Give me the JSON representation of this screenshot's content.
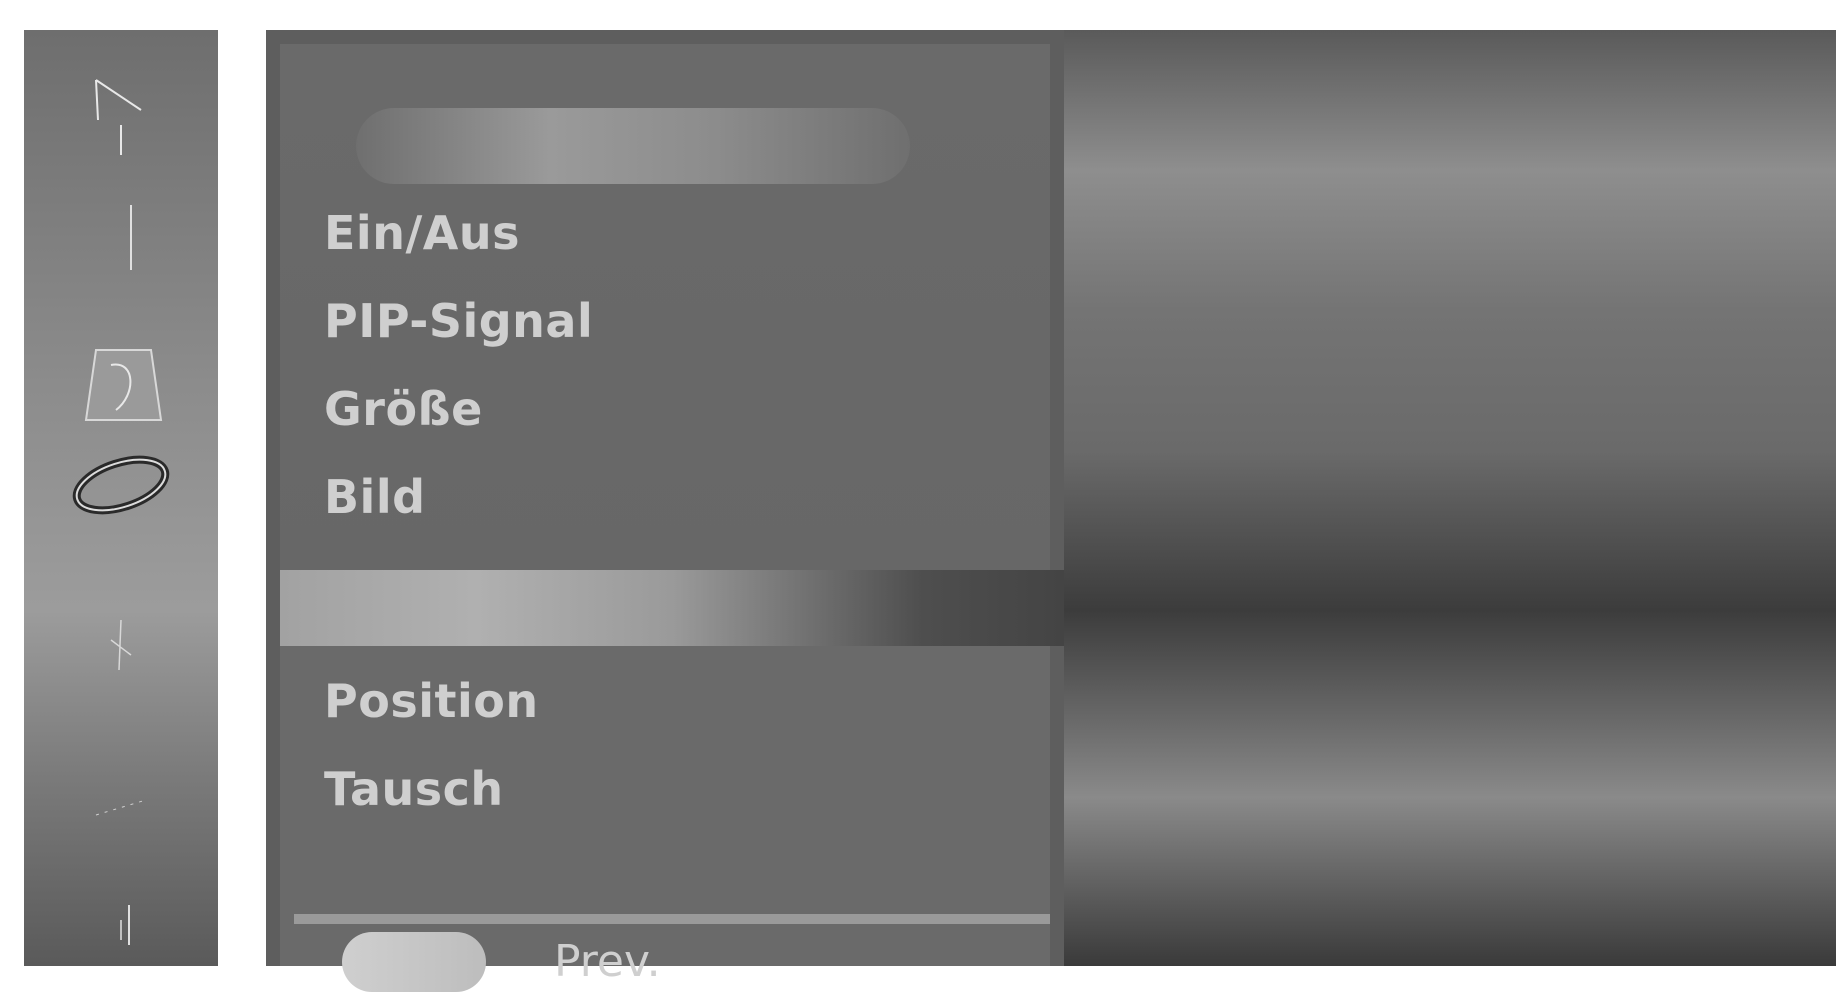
{
  "menu": {
    "items": [
      "Ein/Aus",
      "PIP-Signal",
      "Größe",
      "Bild",
      "Position",
      "Tausch"
    ]
  },
  "footer": {
    "prev_label": "Prev."
  },
  "sidebar": {
    "icons": [
      "antenna-icon",
      "line-icon",
      "picture-icon",
      "ellipse-icon",
      "clock-icon",
      "dots-icon",
      "bar-icon"
    ]
  }
}
